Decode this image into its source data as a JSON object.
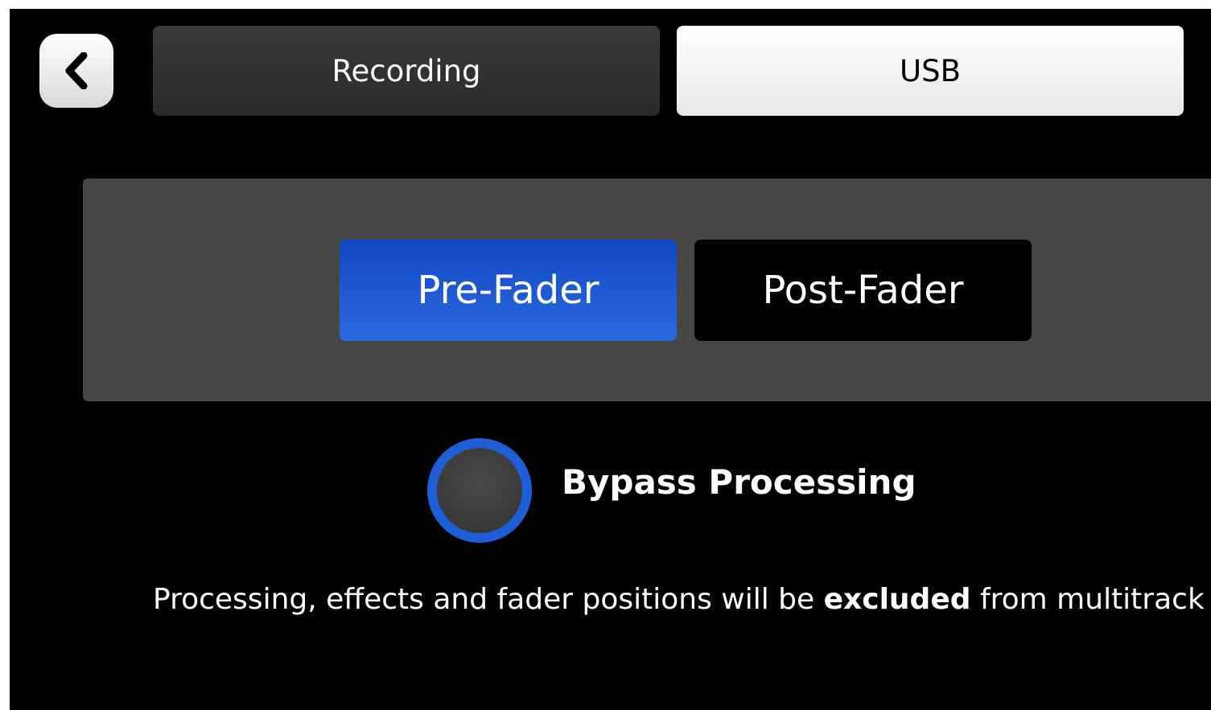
{
  "header": {
    "back_icon": "chevron-left-icon",
    "tabs": [
      {
        "label": "Recording",
        "active": false
      },
      {
        "label": "USB",
        "active": true
      }
    ]
  },
  "tap_point": {
    "options": [
      {
        "label": "Pre-Fader",
        "selected": true
      },
      {
        "label": "Post-Fader",
        "selected": false
      }
    ]
  },
  "bypass": {
    "label": "Bypass Processing",
    "enabled": false,
    "ring_color": "#1e5fd8"
  },
  "info": {
    "prefix": "Processing, effects and fader positions will be ",
    "emphasis": "excluded",
    "suffix": " from multitrack"
  },
  "colors": {
    "accent": "#1e5fd8",
    "background": "#000000",
    "panel": "#474747"
  }
}
